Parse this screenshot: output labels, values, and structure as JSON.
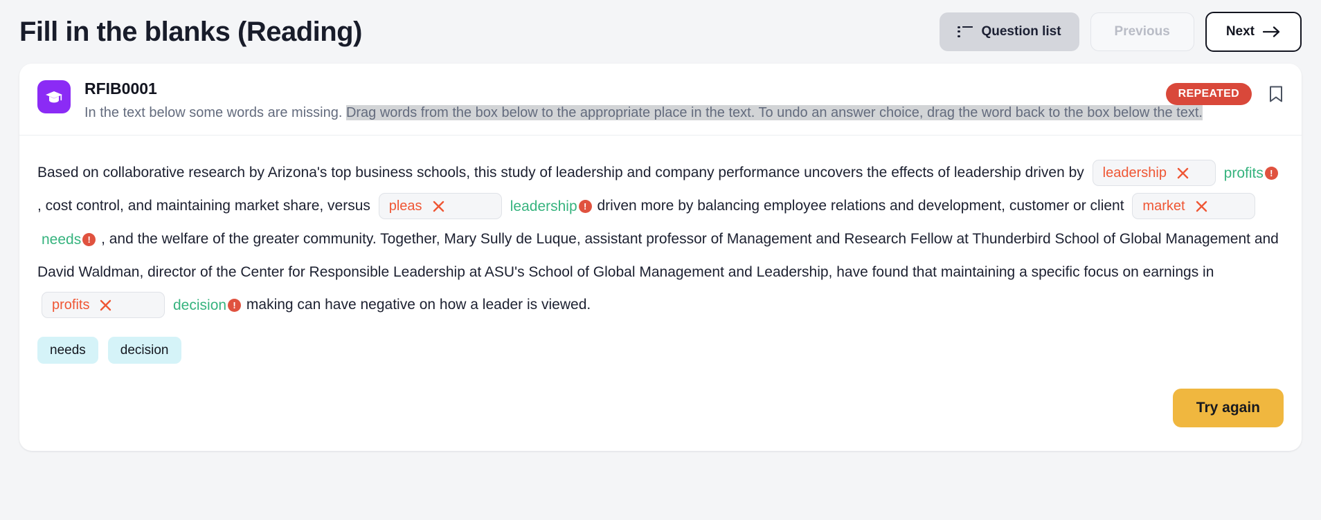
{
  "header": {
    "title": "Fill in the blanks (Reading)",
    "question_list_label": "Question list",
    "previous_label": "Previous",
    "next_label": "Next",
    "list_icon": "list-icon",
    "arrow_icon": "arrow-right-icon"
  },
  "question": {
    "id": "RFIB0001",
    "icon": "graduation-cap-icon",
    "badge": "REPEATED",
    "bookmark_icon": "bookmark-icon",
    "instruction_plain": "In the text below some words are missing.",
    "instruction_highlighted": "Drag words from the box below to the appropriate place in the text. To undo an answer choice, drag the word back to the box below the text.",
    "accent_purple": "#8b2bf5",
    "badge_color": "#d9483a"
  },
  "passage": {
    "segments": [
      {
        "type": "text",
        "value": "Based on collaborative research by Arizona's top business schools, this study of leadership and company performance uncovers the effects of leadership driven by"
      },
      {
        "type": "blank",
        "user_answer": "leadership",
        "correct_answer": "profits"
      },
      {
        "type": "text",
        "value": ", cost control, and maintaining market share, versus"
      },
      {
        "type": "blank",
        "user_answer": "pleas",
        "correct_answer": "leadership"
      },
      {
        "type": "text",
        "value": "driven more by balancing employee relations and development, customer or client"
      },
      {
        "type": "blank",
        "user_answer": "market",
        "correct_answer": "needs"
      },
      {
        "type": "text",
        "value": ", and the welfare of the greater community. Together, Mary Sully de Luque, assistant professor of Management and Research Fellow at Thunderbird School of Global Management and David Waldman, director of the Center for Responsible Leadership at ASU's School of Global Management and Leadership, have found that maintaining a specific focus on earnings in"
      },
      {
        "type": "blank",
        "user_answer": "profits",
        "correct_answer": "decision"
      },
      {
        "type": "text",
        "value": "making can have negative on how a leader is viewed."
      }
    ],
    "wrong_color": "#ef5634",
    "correct_color": "#36b37e",
    "error_icon": "exclamation-icon",
    "remove_icon": "x-icon"
  },
  "word_bank": [
    "needs",
    "decision"
  ],
  "footer": {
    "try_again_label": "Try again",
    "try_again_color": "#f0b73f"
  }
}
